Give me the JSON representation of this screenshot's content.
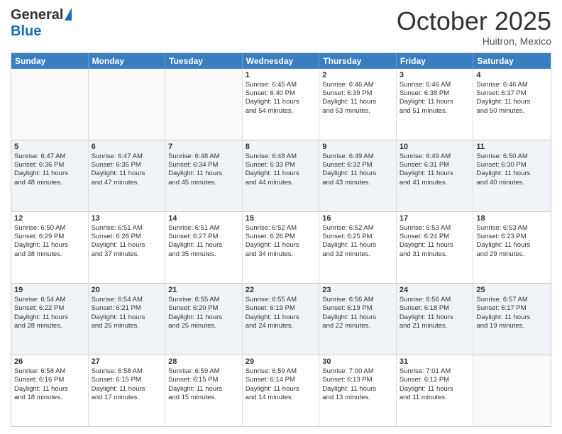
{
  "header": {
    "logo_general": "General",
    "logo_blue": "Blue",
    "month_title": "October 2025",
    "subtitle": "Huitron, Mexico"
  },
  "weekdays": [
    "Sunday",
    "Monday",
    "Tuesday",
    "Wednesday",
    "Thursday",
    "Friday",
    "Saturday"
  ],
  "rows": [
    {
      "alt": false,
      "cells": [
        {
          "day": "",
          "lines": []
        },
        {
          "day": "",
          "lines": []
        },
        {
          "day": "",
          "lines": []
        },
        {
          "day": "1",
          "lines": [
            "Sunrise: 6:45 AM",
            "Sunset: 6:40 PM",
            "Daylight: 11 hours",
            "and 54 minutes."
          ]
        },
        {
          "day": "2",
          "lines": [
            "Sunrise: 6:46 AM",
            "Sunset: 6:39 PM",
            "Daylight: 11 hours",
            "and 53 minutes."
          ]
        },
        {
          "day": "3",
          "lines": [
            "Sunrise: 6:46 AM",
            "Sunset: 6:38 PM",
            "Daylight: 11 hours",
            "and 51 minutes."
          ]
        },
        {
          "day": "4",
          "lines": [
            "Sunrise: 6:46 AM",
            "Sunset: 6:37 PM",
            "Daylight: 11 hours",
            "and 50 minutes."
          ]
        }
      ]
    },
    {
      "alt": true,
      "cells": [
        {
          "day": "5",
          "lines": [
            "Sunrise: 6:47 AM",
            "Sunset: 6:36 PM",
            "Daylight: 11 hours",
            "and 48 minutes."
          ]
        },
        {
          "day": "6",
          "lines": [
            "Sunrise: 6:47 AM",
            "Sunset: 6:35 PM",
            "Daylight: 11 hours",
            "and 47 minutes."
          ]
        },
        {
          "day": "7",
          "lines": [
            "Sunrise: 6:48 AM",
            "Sunset: 6:34 PM",
            "Daylight: 11 hours",
            "and 45 minutes."
          ]
        },
        {
          "day": "8",
          "lines": [
            "Sunrise: 6:48 AM",
            "Sunset: 6:33 PM",
            "Daylight: 11 hours",
            "and 44 minutes."
          ]
        },
        {
          "day": "9",
          "lines": [
            "Sunrise: 6:49 AM",
            "Sunset: 6:32 PM",
            "Daylight: 11 hours",
            "and 43 minutes."
          ]
        },
        {
          "day": "10",
          "lines": [
            "Sunrise: 6:49 AM",
            "Sunset: 6:31 PM",
            "Daylight: 11 hours",
            "and 41 minutes."
          ]
        },
        {
          "day": "11",
          "lines": [
            "Sunrise: 6:50 AM",
            "Sunset: 6:30 PM",
            "Daylight: 11 hours",
            "and 40 minutes."
          ]
        }
      ]
    },
    {
      "alt": false,
      "cells": [
        {
          "day": "12",
          "lines": [
            "Sunrise: 6:50 AM",
            "Sunset: 6:29 PM",
            "Daylight: 11 hours",
            "and 38 minutes."
          ]
        },
        {
          "day": "13",
          "lines": [
            "Sunrise: 6:51 AM",
            "Sunset: 6:28 PM",
            "Daylight: 11 hours",
            "and 37 minutes."
          ]
        },
        {
          "day": "14",
          "lines": [
            "Sunrise: 6:51 AM",
            "Sunset: 6:27 PM",
            "Daylight: 11 hours",
            "and 35 minutes."
          ]
        },
        {
          "day": "15",
          "lines": [
            "Sunrise: 6:52 AM",
            "Sunset: 6:26 PM",
            "Daylight: 11 hours",
            "and 34 minutes."
          ]
        },
        {
          "day": "16",
          "lines": [
            "Sunrise: 6:52 AM",
            "Sunset: 6:25 PM",
            "Daylight: 11 hours",
            "and 32 minutes."
          ]
        },
        {
          "day": "17",
          "lines": [
            "Sunrise: 6:53 AM",
            "Sunset: 6:24 PM",
            "Daylight: 11 hours",
            "and 31 minutes."
          ]
        },
        {
          "day": "18",
          "lines": [
            "Sunrise: 6:53 AM",
            "Sunset: 6:23 PM",
            "Daylight: 11 hours",
            "and 29 minutes."
          ]
        }
      ]
    },
    {
      "alt": true,
      "cells": [
        {
          "day": "19",
          "lines": [
            "Sunrise: 6:54 AM",
            "Sunset: 6:22 PM",
            "Daylight: 11 hours",
            "and 28 minutes."
          ]
        },
        {
          "day": "20",
          "lines": [
            "Sunrise: 6:54 AM",
            "Sunset: 6:21 PM",
            "Daylight: 11 hours",
            "and 26 minutes."
          ]
        },
        {
          "day": "21",
          "lines": [
            "Sunrise: 6:55 AM",
            "Sunset: 6:20 PM",
            "Daylight: 11 hours",
            "and 25 minutes."
          ]
        },
        {
          "day": "22",
          "lines": [
            "Sunrise: 6:55 AM",
            "Sunset: 6:19 PM",
            "Daylight: 11 hours",
            "and 24 minutes."
          ]
        },
        {
          "day": "23",
          "lines": [
            "Sunrise: 6:56 AM",
            "Sunset: 6:19 PM",
            "Daylight: 11 hours",
            "and 22 minutes."
          ]
        },
        {
          "day": "24",
          "lines": [
            "Sunrise: 6:56 AM",
            "Sunset: 6:18 PM",
            "Daylight: 11 hours",
            "and 21 minutes."
          ]
        },
        {
          "day": "25",
          "lines": [
            "Sunrise: 6:57 AM",
            "Sunset: 6:17 PM",
            "Daylight: 11 hours",
            "and 19 minutes."
          ]
        }
      ]
    },
    {
      "alt": false,
      "cells": [
        {
          "day": "26",
          "lines": [
            "Sunrise: 6:58 AM",
            "Sunset: 6:16 PM",
            "Daylight: 11 hours",
            "and 18 minutes."
          ]
        },
        {
          "day": "27",
          "lines": [
            "Sunrise: 6:58 AM",
            "Sunset: 6:15 PM",
            "Daylight: 11 hours",
            "and 17 minutes."
          ]
        },
        {
          "day": "28",
          "lines": [
            "Sunrise: 6:59 AM",
            "Sunset: 6:15 PM",
            "Daylight: 11 hours",
            "and 15 minutes."
          ]
        },
        {
          "day": "29",
          "lines": [
            "Sunrise: 6:59 AM",
            "Sunset: 6:14 PM",
            "Daylight: 11 hours",
            "and 14 minutes."
          ]
        },
        {
          "day": "30",
          "lines": [
            "Sunrise: 7:00 AM",
            "Sunset: 6:13 PM",
            "Daylight: 11 hours",
            "and 13 minutes."
          ]
        },
        {
          "day": "31",
          "lines": [
            "Sunrise: 7:01 AM",
            "Sunset: 6:12 PM",
            "Daylight: 11 hours",
            "and 11 minutes."
          ]
        },
        {
          "day": "",
          "lines": []
        }
      ]
    }
  ]
}
